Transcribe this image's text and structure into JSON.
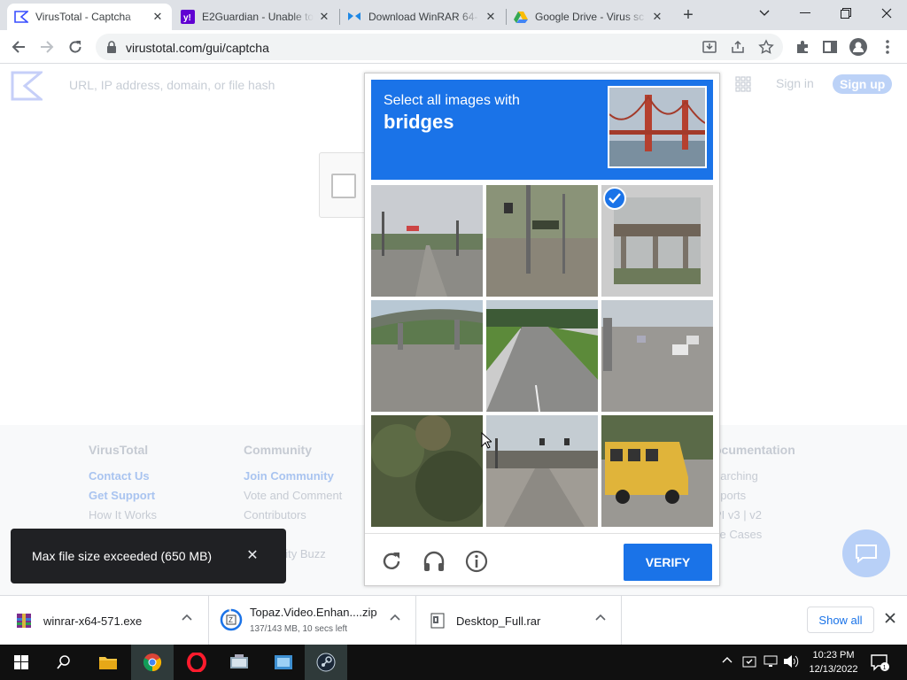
{
  "browser": {
    "tabs": [
      {
        "title": "VirusTotal - Captcha",
        "active": true
      },
      {
        "title": "E2Guardian - Unable to",
        "active": false
      },
      {
        "title": "Download WinRAR 64-",
        "active": false
      },
      {
        "title": "Google Drive - Virus sc",
        "active": false
      }
    ],
    "url": "virustotal.com/gui/captcha"
  },
  "virustotal": {
    "search_placeholder": "URL, IP address, domain, or file hash",
    "sign_in": "Sign in",
    "sign_up": "Sign up",
    "footer": [
      {
        "heading": "VirusTotal",
        "links": [
          "Contact Us",
          "Get Support",
          "How It Works"
        ]
      },
      {
        "heading": "Community",
        "links": [
          "Join Community",
          "Vote and Comment",
          "Contributors",
          "rs",
          "nity Buzz"
        ]
      },
      {
        "heading": "ocumentation",
        "links": [
          "earching",
          "eports",
          "PI v3 | v2",
          "se Cases"
        ]
      }
    ]
  },
  "captcha": {
    "instruction": "Select all images with",
    "target": "bridges",
    "verify_label": "VERIFY",
    "selected_tiles": [
      2
    ],
    "tiles": [
      "road-with-signs",
      "street-with-traffic-lights",
      "highway-overpass",
      "highway-overpass",
      "empty-road",
      "highway-with-cars",
      "trees",
      "overpass-with-traffic-lights",
      "school-bus"
    ]
  },
  "snackbar": {
    "message": "Max file size exceeded (650 MB)"
  },
  "downloads": [
    {
      "name": "winrar-x64-571.exe",
      "status": ""
    },
    {
      "name": "Topaz.Video.Enhan....zip",
      "status": "137/143 MB, 10 secs left"
    },
    {
      "name": "Desktop_Full.rar",
      "status": ""
    }
  ],
  "downloads_show_all": "Show all",
  "taskbar": {
    "time": "10:23 PM",
    "date": "12/13/2022"
  },
  "colors": {
    "accent": "#1a73e8",
    "chrome_bg": "#dee1e6",
    "taskbar": "#101010"
  }
}
